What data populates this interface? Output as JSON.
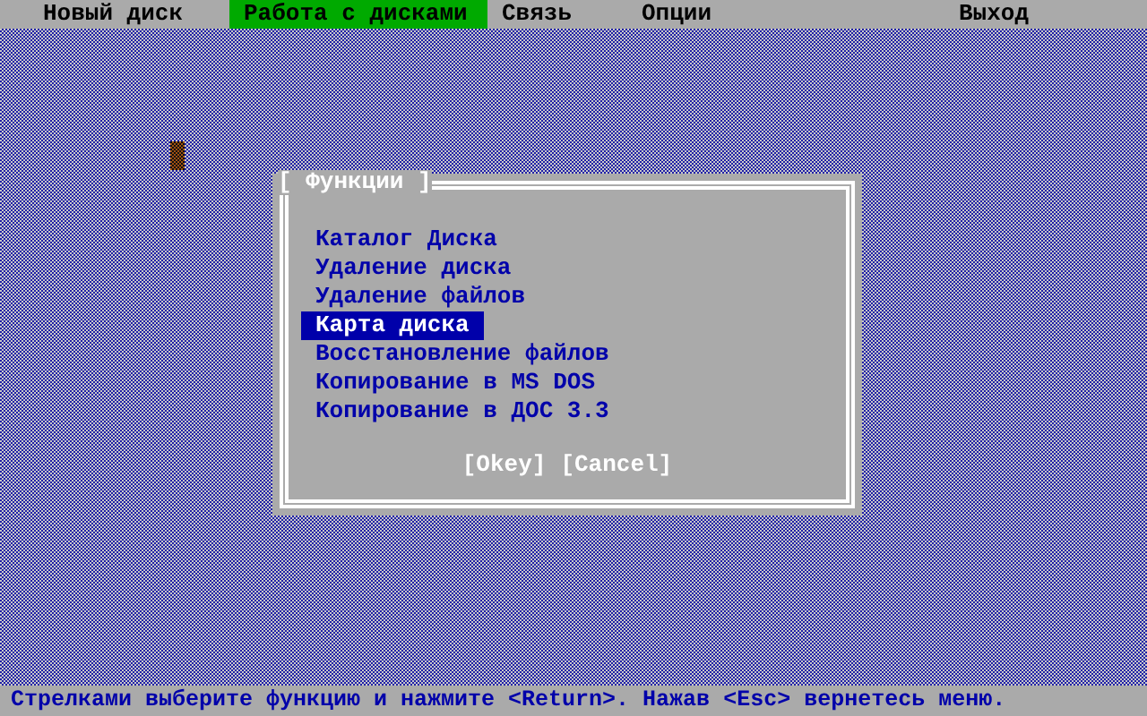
{
  "menu_bar": [
    {
      "label": "Новый диск",
      "selected": false
    },
    {
      "label": "Работа с дисками",
      "selected": true
    },
    {
      "label": "Связь",
      "selected": false
    },
    {
      "label": "Опции",
      "selected": false
    },
    {
      "label": "Выход",
      "selected": false
    }
  ],
  "dialog": {
    "title": "[ Функции ]",
    "items": [
      {
        "label": "Каталог Диска",
        "selected": false
      },
      {
        "label": "Удаление диска",
        "selected": false
      },
      {
        "label": "Удаление файлов",
        "selected": false
      },
      {
        "label": "Карта диска",
        "selected": true
      },
      {
        "label": "Восстановление файлов",
        "selected": false
      },
      {
        "label": "Копирование в MS DOS",
        "selected": false
      },
      {
        "label": "Копирование в ДОС 3.3",
        "selected": false
      }
    ],
    "buttons": [
      "[Okey]",
      "[Cancel]"
    ]
  },
  "status_bar": "Стрелками выберите функцию и нажмите <Return>. Нажав <Esc> вернетесь меню."
}
